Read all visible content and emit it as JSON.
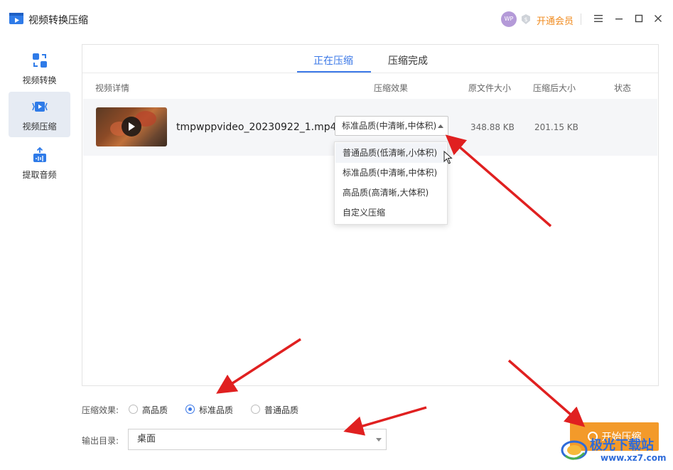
{
  "app": {
    "title": "视频转换压缩"
  },
  "titlebar": {
    "avatar_text": "WP",
    "vip_label": "开通会员"
  },
  "sidebar": {
    "items": [
      {
        "label": "视频转换"
      },
      {
        "label": "视频压缩"
      },
      {
        "label": "提取音频"
      }
    ],
    "active_index": 1
  },
  "tabs": [
    {
      "label": "正在压缩"
    },
    {
      "label": "压缩完成"
    }
  ],
  "columns": {
    "details": "视频详情",
    "effect": "压缩效果",
    "original_size": "原文件大小",
    "compressed_size": "压缩后大小",
    "status": "状态"
  },
  "file": {
    "name": "tmpwppvideo_20230922_1.mp4",
    "quality": "标准品质(中清晰,中体积)",
    "original_size": "348.88 KB",
    "compressed_size": "201.15 KB"
  },
  "dropdown": {
    "options": [
      "普通品质(低清晰,小体积)",
      "标准品质(中清晰,中体积)",
      "高品质(高清晰,大体积)",
      "自定义压缩"
    ],
    "hover_index": 0
  },
  "bottom": {
    "effect_label": "压缩效果:",
    "radios": [
      "高品质",
      "标准品质",
      "普通品质"
    ],
    "selected_radio": 1,
    "output_label": "输出目录:",
    "output_value": "桌面",
    "start_label": "开始压缩"
  },
  "watermark": {
    "title": "极光下载站",
    "url": "www.xz7.com"
  },
  "colors": {
    "accent": "#3b78e7",
    "vip": "#f08a1d",
    "start": "#f39a2a",
    "arrow": "#e02020"
  },
  "icons": [
    "app-logo-icon",
    "crown-icon",
    "menu-icon",
    "minimize-icon",
    "maximize-icon",
    "close-icon",
    "convert-icon",
    "compress-icon",
    "audio-extract-icon",
    "play-icon",
    "caret-up-icon",
    "caret-down-icon"
  ]
}
